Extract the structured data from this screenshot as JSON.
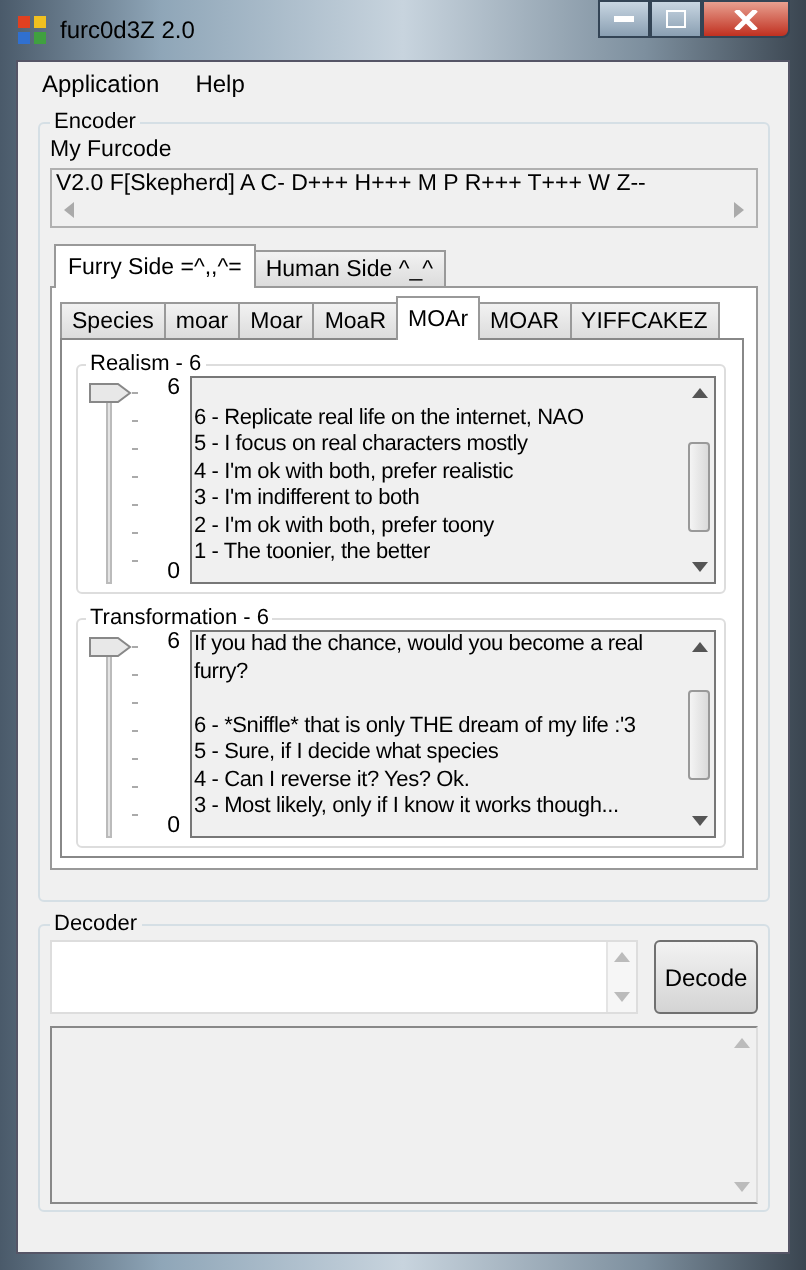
{
  "window": {
    "title": "furc0d3Z 2.0"
  },
  "menu": [
    "Application",
    "Help"
  ],
  "encoder": {
    "title": "Encoder",
    "furcode_label": "My Furcode",
    "furcode": "V2.0 F[Skepherd] A C- D+++ H+++ M P R+++ T+++ W Z--",
    "side_tabs": [
      {
        "label": "Furry Side =^,,^=",
        "selected": true
      },
      {
        "label": "Human Side ^_^",
        "selected": false
      }
    ],
    "category_tabs": [
      {
        "label": "Species",
        "selected": false
      },
      {
        "label": "moar",
        "selected": false
      },
      {
        "label": "Moar",
        "selected": false
      },
      {
        "label": "MoaR",
        "selected": false
      },
      {
        "label": "MOAr",
        "selected": true
      },
      {
        "label": "MOAR",
        "selected": false
      },
      {
        "label": "YIFFCAKEZ",
        "selected": false
      }
    ],
    "questions": [
      {
        "title": "Realism - 6",
        "max": "6",
        "min": "0",
        "level": 1,
        "options": [
          "6 - Replicate real life on the internet, NAO",
          "5 - I focus on real characters mostly",
          "4 - I'm ok with both, prefer realistic",
          "3 - I'm indifferent to both",
          "2 - I'm ok with both, prefer toony",
          "1 - The toonier, the better"
        ]
      },
      {
        "title": "Transformation - 6",
        "max": "6",
        "min": "0",
        "level": 1,
        "question": "If you had the chance, would you become a real furry?",
        "options": [
          "6 - *Sniffle* that is only THE dream of my life :'3",
          "5 - Sure, if I decide what species",
          "4 - Can I reverse it? Yes? Ok.",
          "3 - Most likely, only if I know it works though..."
        ]
      }
    ]
  },
  "decoder": {
    "title": "Decoder",
    "button": "Decode"
  }
}
